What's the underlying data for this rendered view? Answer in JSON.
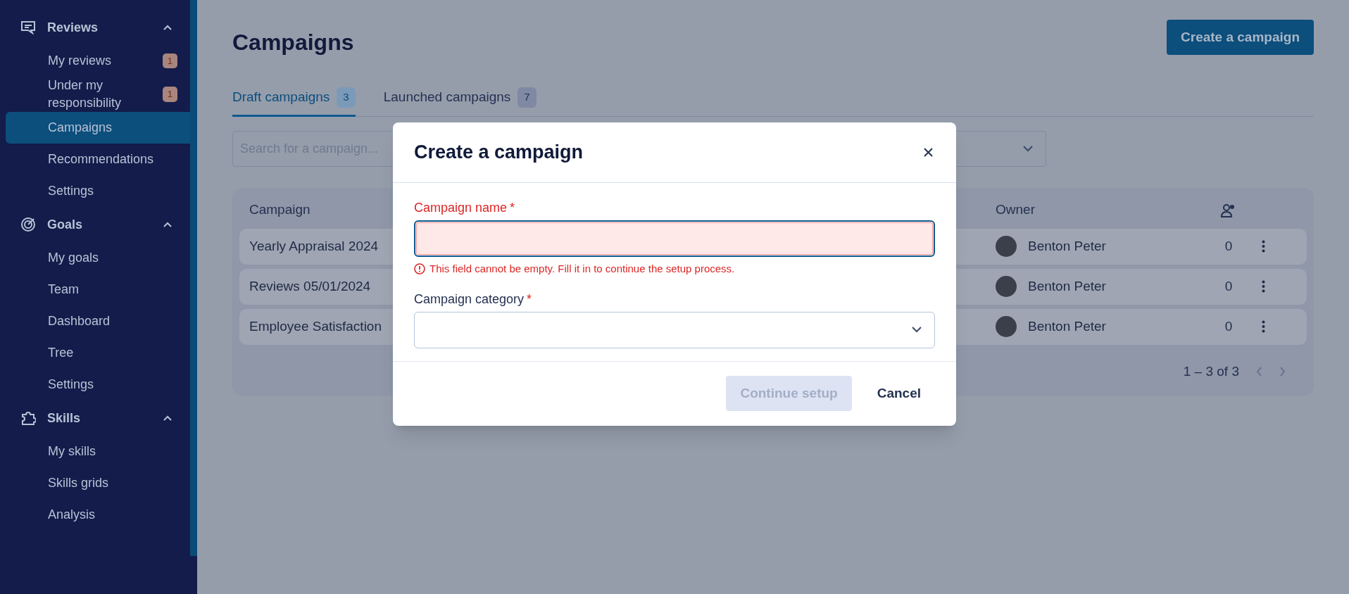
{
  "sidebar": {
    "sections": [
      {
        "title": "Reviews",
        "expanded": true,
        "items": [
          {
            "label": "My reviews",
            "badge": "1",
            "selected": false
          },
          {
            "label": "Under my responsibility",
            "badge": "1",
            "selected": false
          },
          {
            "label": "Campaigns",
            "selected": true
          },
          {
            "label": "Recommendations",
            "selected": false
          },
          {
            "label": "Settings",
            "selected": false
          }
        ]
      },
      {
        "title": "Goals",
        "expanded": true,
        "items": [
          {
            "label": "My goals",
            "selected": false
          },
          {
            "label": "Team",
            "selected": false
          },
          {
            "label": "Dashboard",
            "selected": false
          },
          {
            "label": "Tree",
            "selected": false
          },
          {
            "label": "Settings",
            "selected": false
          }
        ]
      },
      {
        "title": "Skills",
        "expanded": true,
        "items": [
          {
            "label": "My skills",
            "selected": false
          },
          {
            "label": "Skills grids",
            "selected": false
          },
          {
            "label": "Analysis",
            "selected": false
          }
        ]
      }
    ]
  },
  "page": {
    "title": "Campaigns",
    "create_button": "Create a campaign"
  },
  "tabs": [
    {
      "label": "Draft campaigns",
      "count": "3",
      "selected": true
    },
    {
      "label": "Launched campaigns",
      "count": "7",
      "selected": false
    }
  ],
  "search": {
    "placeholder": "Search for a campaign..."
  },
  "table": {
    "columns": [
      "Campaign",
      "Owner"
    ],
    "rows": [
      {
        "campaign": "Yearly Appraisal 2024",
        "owner": "Benton Peter",
        "count": "0"
      },
      {
        "campaign": "Reviews 05/01/2024",
        "owner": "Benton Peter",
        "count": "0"
      },
      {
        "campaign": "Employee Satisfaction",
        "owner": "Benton Peter",
        "count": "0"
      }
    ],
    "pagination": "1 – 3 of 3"
  },
  "modal": {
    "title": "Create a campaign",
    "fields": [
      {
        "kind": "text",
        "label": "Campaign name",
        "required": "*",
        "error": "This field cannot be empty. Fill it in to continue the setup process."
      },
      {
        "kind": "select",
        "label": "Campaign category",
        "required": "*"
      }
    ],
    "buttons": [
      {
        "kind": "primary",
        "label": "Continue setup",
        "disabled": true
      },
      {
        "kind": "text",
        "label": "Cancel",
        "disabled": false
      }
    ]
  }
}
